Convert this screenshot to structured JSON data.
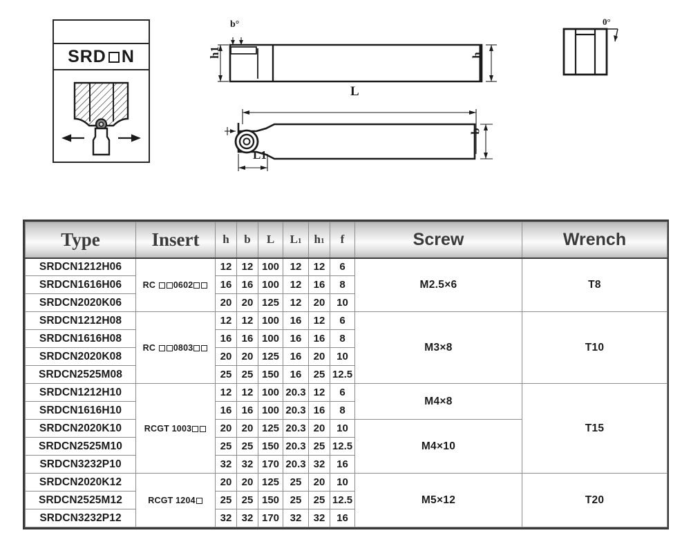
{
  "symbol_box": {
    "code_prefix": "SRD",
    "code_suffix": "N",
    "square_placeholder": "□"
  },
  "diagram": {
    "labels": {
      "angle_b": "b°",
      "h1": "h1",
      "h": "h",
      "L": "L",
      "L1": "L1",
      "b": "b",
      "angle_zero": "0°"
    }
  },
  "table": {
    "headers": {
      "type": "Type",
      "insert": "Insert",
      "h": "h",
      "b": "b",
      "L": "L",
      "L1": "L",
      "L1_sub": "1",
      "h1": "h",
      "h1_sub": "1",
      "f": "f",
      "screw": "Screw",
      "wrench": "Wrench"
    },
    "groups": [
      {
        "insert_text": "RC",
        "insert_code": "0602",
        "insert_squares_before": 2,
        "insert_squares_after": 2,
        "screw": "M2.5×6",
        "wrench": "T8",
        "rows": [
          {
            "type": "SRDCN1212H06",
            "h": "12",
            "b": "12",
            "L": "100",
            "L1": "12",
            "h1": "12",
            "f": "6"
          },
          {
            "type": "SRDCN1616H06",
            "h": "16",
            "b": "16",
            "L": "100",
            "L1": "12",
            "h1": "16",
            "f": "8"
          },
          {
            "type": "SRDCN2020K06",
            "h": "20",
            "b": "20",
            "L": "125",
            "L1": "12",
            "h1": "20",
            "f": "10"
          }
        ]
      },
      {
        "insert_text": "RC",
        "insert_code": "0803",
        "insert_squares_before": 2,
        "insert_squares_after": 2,
        "screw": "M3×8",
        "wrench": "T10",
        "rows": [
          {
            "type": "SRDCN1212H08",
            "h": "12",
            "b": "12",
            "L": "100",
            "L1": "16",
            "h1": "12",
            "f": "6"
          },
          {
            "type": "SRDCN1616H08",
            "h": "16",
            "b": "16",
            "L": "100",
            "L1": "16",
            "h1": "16",
            "f": "8"
          },
          {
            "type": "SRDCN2020K08",
            "h": "20",
            "b": "20",
            "L": "125",
            "L1": "16",
            "h1": "20",
            "f": "10"
          },
          {
            "type": "SRDCN2525M08",
            "h": "25",
            "b": "25",
            "L": "150",
            "L1": "16",
            "h1": "25",
            "f": "12.5"
          }
        ]
      },
      {
        "insert_text": "RCGT 1003",
        "insert_code": "",
        "insert_squares_before": 0,
        "insert_squares_after": 2,
        "screw_parts": [
          {
            "label": "M4×8",
            "span": 2
          },
          {
            "label": "M4×10",
            "span": 3
          }
        ],
        "wrench": "T15",
        "rows": [
          {
            "type": "SRDCN1212H10",
            "h": "12",
            "b": "12",
            "L": "100",
            "L1": "20.3",
            "h1": "12",
            "f": "6"
          },
          {
            "type": "SRDCN1616H10",
            "h": "16",
            "b": "16",
            "L": "100",
            "L1": "20.3",
            "h1": "16",
            "f": "8"
          },
          {
            "type": "SRDCN2020K10",
            "h": "20",
            "b": "20",
            "L": "125",
            "L1": "20.3",
            "h1": "20",
            "f": "10"
          },
          {
            "type": "SRDCN2525M10",
            "h": "25",
            "b": "25",
            "L": "150",
            "L1": "20.3",
            "h1": "25",
            "f": "12.5"
          },
          {
            "type": "SRDCN3232P10",
            "h": "32",
            "b": "32",
            "L": "170",
            "L1": "20.3",
            "h1": "32",
            "f": "16"
          }
        ]
      },
      {
        "insert_text": "RCGT 1204",
        "insert_code": "",
        "insert_squares_before": 0,
        "insert_squares_after": 1,
        "screw": "M5×12",
        "wrench": "T20",
        "rows": [
          {
            "type": "SRDCN2020K12",
            "h": "20",
            "b": "20",
            "L": "125",
            "L1": "25",
            "h1": "20",
            "f": "10"
          },
          {
            "type": "SRDCN2525M12",
            "h": "25",
            "b": "25",
            "L": "150",
            "L1": "25",
            "h1": "25",
            "f": "12.5"
          },
          {
            "type": "SRDCN3232P12",
            "h": "32",
            "b": "32",
            "L": "170",
            "L1": "32",
            "h1": "32",
            "f": "16"
          }
        ]
      }
    ]
  },
  "colors": {
    "line": "#1a1a1a",
    "border": "#3a3a3a",
    "grid": "#8c8c8c",
    "header_text": "#3a3a3a"
  }
}
